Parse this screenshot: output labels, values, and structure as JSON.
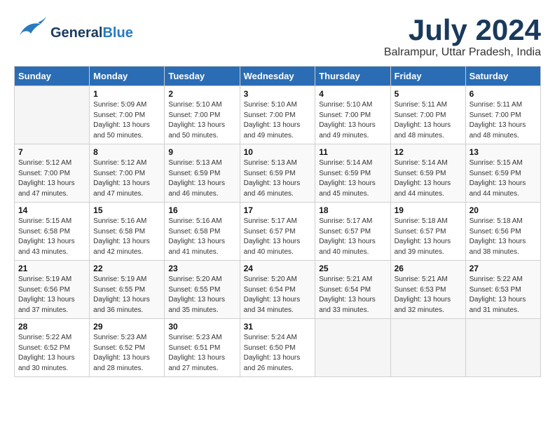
{
  "header": {
    "logo_line1": "General",
    "logo_line2": "Blue",
    "main_title": "July 2024",
    "subtitle": "Balrampur, Uttar Pradesh, India"
  },
  "columns": [
    "Sunday",
    "Monday",
    "Tuesday",
    "Wednesday",
    "Thursday",
    "Friday",
    "Saturday"
  ],
  "weeks": [
    [
      {
        "day": "",
        "info": ""
      },
      {
        "day": "1",
        "info": "Sunrise: 5:09 AM\nSunset: 7:00 PM\nDaylight: 13 hours\nand 50 minutes."
      },
      {
        "day": "2",
        "info": "Sunrise: 5:10 AM\nSunset: 7:00 PM\nDaylight: 13 hours\nand 50 minutes."
      },
      {
        "day": "3",
        "info": "Sunrise: 5:10 AM\nSunset: 7:00 PM\nDaylight: 13 hours\nand 49 minutes."
      },
      {
        "day": "4",
        "info": "Sunrise: 5:10 AM\nSunset: 7:00 PM\nDaylight: 13 hours\nand 49 minutes."
      },
      {
        "day": "5",
        "info": "Sunrise: 5:11 AM\nSunset: 7:00 PM\nDaylight: 13 hours\nand 48 minutes."
      },
      {
        "day": "6",
        "info": "Sunrise: 5:11 AM\nSunset: 7:00 PM\nDaylight: 13 hours\nand 48 minutes."
      }
    ],
    [
      {
        "day": "7",
        "info": "Sunrise: 5:12 AM\nSunset: 7:00 PM\nDaylight: 13 hours\nand 47 minutes."
      },
      {
        "day": "8",
        "info": "Sunrise: 5:12 AM\nSunset: 7:00 PM\nDaylight: 13 hours\nand 47 minutes."
      },
      {
        "day": "9",
        "info": "Sunrise: 5:13 AM\nSunset: 6:59 PM\nDaylight: 13 hours\nand 46 minutes."
      },
      {
        "day": "10",
        "info": "Sunrise: 5:13 AM\nSunset: 6:59 PM\nDaylight: 13 hours\nand 46 minutes."
      },
      {
        "day": "11",
        "info": "Sunrise: 5:14 AM\nSunset: 6:59 PM\nDaylight: 13 hours\nand 45 minutes."
      },
      {
        "day": "12",
        "info": "Sunrise: 5:14 AM\nSunset: 6:59 PM\nDaylight: 13 hours\nand 44 minutes."
      },
      {
        "day": "13",
        "info": "Sunrise: 5:15 AM\nSunset: 6:59 PM\nDaylight: 13 hours\nand 44 minutes."
      }
    ],
    [
      {
        "day": "14",
        "info": "Sunrise: 5:15 AM\nSunset: 6:58 PM\nDaylight: 13 hours\nand 43 minutes."
      },
      {
        "day": "15",
        "info": "Sunrise: 5:16 AM\nSunset: 6:58 PM\nDaylight: 13 hours\nand 42 minutes."
      },
      {
        "day": "16",
        "info": "Sunrise: 5:16 AM\nSunset: 6:58 PM\nDaylight: 13 hours\nand 41 minutes."
      },
      {
        "day": "17",
        "info": "Sunrise: 5:17 AM\nSunset: 6:57 PM\nDaylight: 13 hours\nand 40 minutes."
      },
      {
        "day": "18",
        "info": "Sunrise: 5:17 AM\nSunset: 6:57 PM\nDaylight: 13 hours\nand 40 minutes."
      },
      {
        "day": "19",
        "info": "Sunrise: 5:18 AM\nSunset: 6:57 PM\nDaylight: 13 hours\nand 39 minutes."
      },
      {
        "day": "20",
        "info": "Sunrise: 5:18 AM\nSunset: 6:56 PM\nDaylight: 13 hours\nand 38 minutes."
      }
    ],
    [
      {
        "day": "21",
        "info": "Sunrise: 5:19 AM\nSunset: 6:56 PM\nDaylight: 13 hours\nand 37 minutes."
      },
      {
        "day": "22",
        "info": "Sunrise: 5:19 AM\nSunset: 6:55 PM\nDaylight: 13 hours\nand 36 minutes."
      },
      {
        "day": "23",
        "info": "Sunrise: 5:20 AM\nSunset: 6:55 PM\nDaylight: 13 hours\nand 35 minutes."
      },
      {
        "day": "24",
        "info": "Sunrise: 5:20 AM\nSunset: 6:54 PM\nDaylight: 13 hours\nand 34 minutes."
      },
      {
        "day": "25",
        "info": "Sunrise: 5:21 AM\nSunset: 6:54 PM\nDaylight: 13 hours\nand 33 minutes."
      },
      {
        "day": "26",
        "info": "Sunrise: 5:21 AM\nSunset: 6:53 PM\nDaylight: 13 hours\nand 32 minutes."
      },
      {
        "day": "27",
        "info": "Sunrise: 5:22 AM\nSunset: 6:53 PM\nDaylight: 13 hours\nand 31 minutes."
      }
    ],
    [
      {
        "day": "28",
        "info": "Sunrise: 5:22 AM\nSunset: 6:52 PM\nDaylight: 13 hours\nand 30 minutes."
      },
      {
        "day": "29",
        "info": "Sunrise: 5:23 AM\nSunset: 6:52 PM\nDaylight: 13 hours\nand 28 minutes."
      },
      {
        "day": "30",
        "info": "Sunrise: 5:23 AM\nSunset: 6:51 PM\nDaylight: 13 hours\nand 27 minutes."
      },
      {
        "day": "31",
        "info": "Sunrise: 5:24 AM\nSunset: 6:50 PM\nDaylight: 13 hours\nand 26 minutes."
      },
      {
        "day": "",
        "info": ""
      },
      {
        "day": "",
        "info": ""
      },
      {
        "day": "",
        "info": ""
      }
    ]
  ]
}
